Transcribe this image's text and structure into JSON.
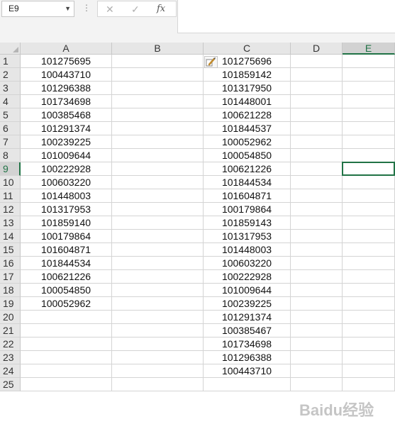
{
  "name_box": {
    "value": "E9"
  },
  "formula_bar": {
    "more_icon": "⋮",
    "cancel_icon": "✕",
    "enter_icon": "✓",
    "fx_label": "fx",
    "formula": ""
  },
  "columns": [
    "A",
    "B",
    "C",
    "D",
    "E"
  ],
  "selected_column": "E",
  "selected_row": 9,
  "rows": [
    1,
    2,
    3,
    4,
    5,
    6,
    7,
    8,
    9,
    10,
    11,
    12,
    13,
    14,
    15,
    16,
    17,
    18,
    19,
    20,
    21,
    22,
    23,
    24,
    25
  ],
  "column_a": [
    "101275695",
    "100443710",
    "101296388",
    "101734698",
    "100385468",
    "101291374",
    "100239225",
    "101009644",
    "100222928",
    "100603220",
    "101448003",
    "101317953",
    "101859140",
    "100179864",
    "101604871",
    "101844534",
    "100621226",
    "100054850",
    "100052962",
    "",
    "",
    "",
    "",
    "",
    ""
  ],
  "column_c": [
    "101275696",
    "101859142",
    "101317950",
    "101448001",
    "100621228",
    "101844537",
    "100052962",
    "100054850",
    "100621226",
    "101844534",
    "101604871",
    "100179864",
    "101859143",
    "101317953",
    "101448003",
    "100603220",
    "100222928",
    "101009644",
    "100239225",
    "101291374",
    "100385467",
    "101734698",
    "101296388",
    "100443710",
    ""
  ],
  "paste_options_icon": "paste-options-icon",
  "watermark": {
    "text": "Baidu经验"
  },
  "accent_color": "#217346"
}
